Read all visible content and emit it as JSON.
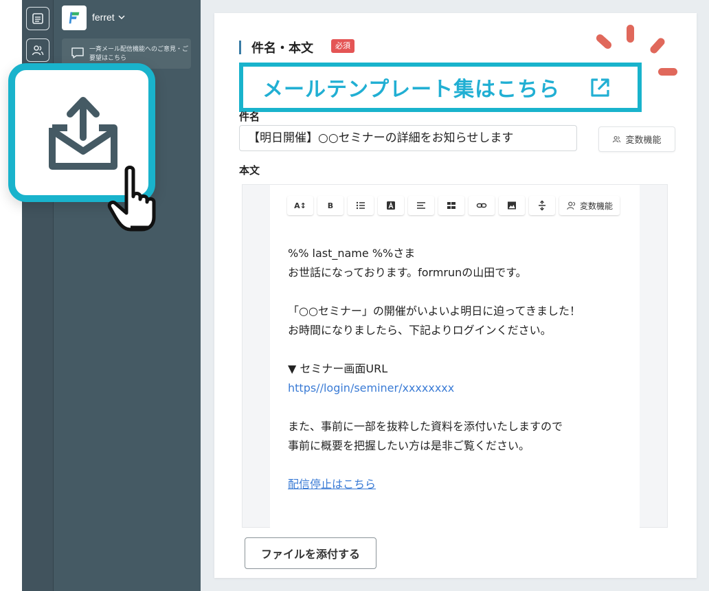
{
  "workspace": {
    "name": "ferret",
    "feedback_text": "一斉メール配信機能へのご意見・ご要望はこちら"
  },
  "form": {
    "section_title": "件名・本文",
    "required_badge": "必須",
    "template_link_label": "メールテンプレート集はこちら",
    "subject": {
      "label": "件名",
      "value": "【明日開催】○○セミナーの詳細をお知らせします"
    },
    "variable_button_label": "変数機能",
    "body": {
      "label": "本文",
      "toolbar": {
        "font_size_label": "A↕",
        "bold_label": "B",
        "variable_label": "変数機能"
      },
      "lines": [
        "%% last_name %%さま",
        "お世話になっております。formrunの山田です。",
        "",
        "「○○セミナー」の開催がいよいよ明日に迫ってきました！",
        "お時間になりましたら、下記よりログインください。",
        "",
        "▼ セミナー画面URL",
        "https//login/seminer/xxxxxxxx",
        "",
        "また、事前に一部を抜粋した資料を添付いたしますので",
        "事前に概要を把握したい方は是非ご覧ください。",
        "",
        "配信停止はこちら"
      ]
    },
    "attach_button_label": "ファイルを添付する"
  },
  "colors": {
    "accent": "#19b3cc",
    "link": "#3a7bd5",
    "required": "#e45555",
    "sidebar": "#455a64"
  }
}
